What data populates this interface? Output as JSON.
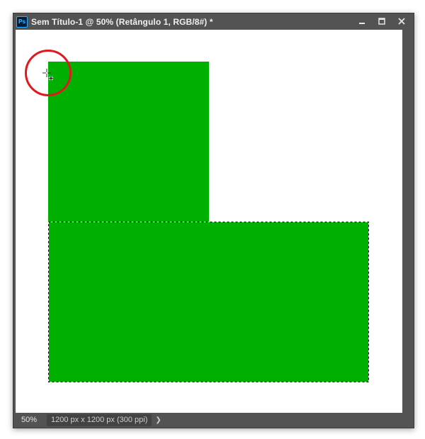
{
  "window": {
    "title": "Sem Título-1 @ 50% (Retângulo 1, RGB/8#) *",
    "app_icon_text": "Ps",
    "controls": [
      "minimize-icon",
      "maximize-icon",
      "close-icon"
    ]
  },
  "canvas": {
    "background": "#ffffff",
    "shape_color": "#00b000",
    "highlight_color": "#e0191f"
  },
  "status": {
    "zoom": "50%",
    "doc_info": "1200 px x 1200 px (300 ppi)",
    "more_icon": "chevron-right-icon"
  }
}
